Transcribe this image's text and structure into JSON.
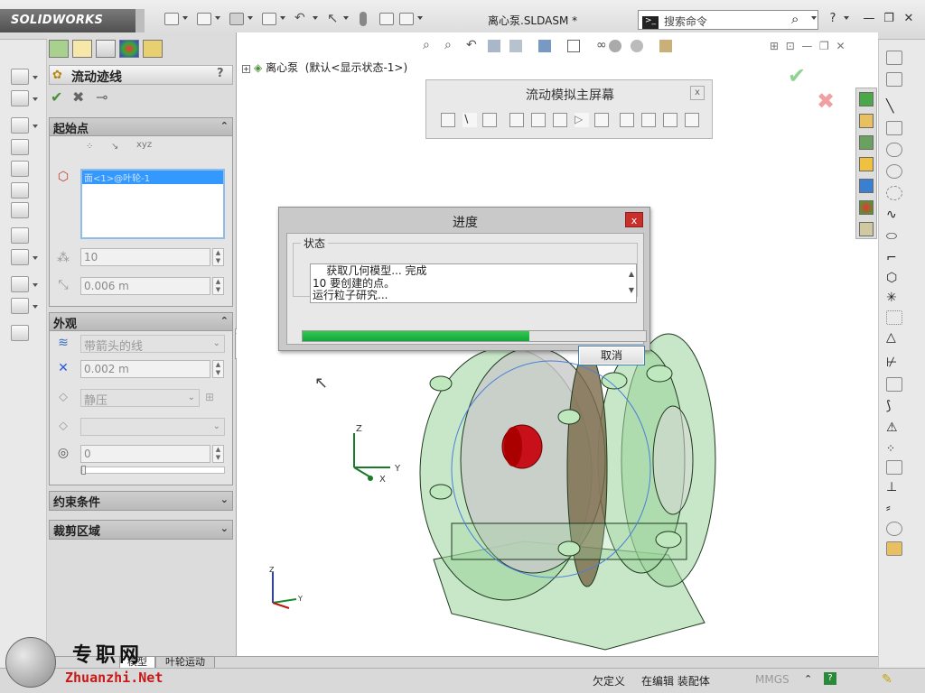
{
  "app": {
    "brand": "SOLIDWORKS",
    "document_title": "离心泵.SLDASM *"
  },
  "search": {
    "placeholder": "搜索命令"
  },
  "property_manager": {
    "title": "流动迹线",
    "help": "?",
    "groups": {
      "start_points": {
        "header": "起始点",
        "selected_item": "面<1>@叶轮-1",
        "count_value": "10",
        "distance_value": "0.006 m"
      },
      "appearance": {
        "header": "外观",
        "draw_style": "带箭头的线",
        "width_value": "0.002 m",
        "color_by": "静压",
        "color_value": "",
        "transparency_value": "0"
      },
      "constraints": {
        "header": "约束条件"
      },
      "clipping": {
        "header": "裁剪区域"
      }
    }
  },
  "feature_tree": {
    "root": "离心泵",
    "config": "(默认<显示状态-1>)"
  },
  "flow_panel": {
    "title": "流动模拟主屏幕",
    "close": "x"
  },
  "progress_dialog": {
    "title": "进度",
    "close": "x",
    "status_label": "状态",
    "status_lines": [
      "    获取几何模型... 完成",
      "10 要创建的点。",
      "运行粒子研究..."
    ],
    "progress_fraction": 0.66,
    "cancel_label": "取消"
  },
  "axes": {
    "x": "X",
    "y": "Y",
    "z": "Z"
  },
  "bottom_tabs": [
    "模型",
    "叶轮运动"
  ],
  "statusbar": {
    "definition": "欠定义",
    "mode": "在编辑 装配体",
    "units": "MMGS"
  },
  "watermark": {
    "cn": "专职网",
    "en": "Zhuanzhi.Net"
  },
  "colors": {
    "progress": "#1db444",
    "model_green": "#8fd38f",
    "impeller_red": "#c8101a",
    "close_red": "#c9302c"
  }
}
